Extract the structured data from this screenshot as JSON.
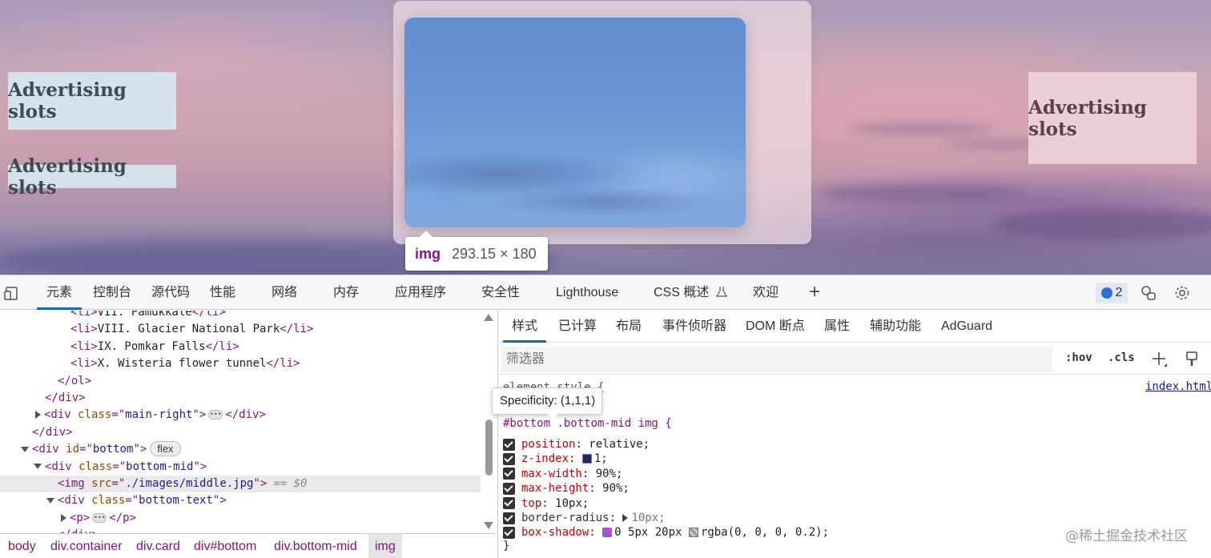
{
  "preview": {
    "ads": [
      "Advertising slots",
      "Advertising slots",
      "Advertising slots"
    ],
    "tooltip": {
      "tag": "img",
      "dims": "293.15 × 180"
    }
  },
  "devtools": {
    "tabs": [
      "元素",
      "控制台",
      "源代码",
      "性能",
      "网络",
      "内存",
      "应用程序",
      "安全性",
      "Lighthouse",
      "CSS 概述",
      "欢迎"
    ],
    "issues_count": "2",
    "elements": {
      "lines": [
        {
          "indent": 88,
          "parts": [
            [
              "tg",
              "<li>"
            ],
            [
              "txt",
              "VII. Pamukkale"
            ],
            [
              "tg",
              "</li>"
            ]
          ]
        },
        {
          "indent": 88,
          "parts": [
            [
              "tg",
              "<li>"
            ],
            [
              "txt",
              "VIII. Glacier National Park"
            ],
            [
              "tg",
              "</li>"
            ]
          ]
        },
        {
          "indent": 88,
          "parts": [
            [
              "tg",
              "<li>"
            ],
            [
              "txt",
              "IX. Pomkar Falls"
            ],
            [
              "tg",
              "</li>"
            ]
          ]
        },
        {
          "indent": 88,
          "parts": [
            [
              "tg",
              "<li>"
            ],
            [
              "txt",
              "X. Wisteria flower tunnel"
            ],
            [
              "tg",
              "</li>"
            ]
          ]
        },
        {
          "indent": 72,
          "parts": [
            [
              "tg",
              "</ol>"
            ]
          ]
        },
        {
          "indent": 56,
          "parts": [
            [
              "tg",
              "</div>"
            ]
          ]
        },
        {
          "indent": 44,
          "arrow": "right",
          "parts": [
            [
              "tg",
              "<div "
            ],
            [
              "at",
              "class"
            ],
            [
              "tg",
              "=\""
            ],
            [
              "av",
              "main-right"
            ],
            [
              "tg",
              "\">"
            ],
            [
              "ell",
              ""
            ],
            [
              "tg",
              "</div>"
            ]
          ]
        },
        {
          "indent": 40,
          "parts": [
            [
              "tg",
              "</div>"
            ]
          ]
        },
        {
          "indent": 26,
          "arrow": "down",
          "parts": [
            [
              "tg",
              "<div "
            ],
            [
              "at",
              "id"
            ],
            [
              "tg",
              "=\""
            ],
            [
              "av",
              "bottom"
            ],
            [
              "tg",
              "\">"
            ],
            [
              "pill",
              "flex"
            ]
          ]
        },
        {
          "indent": 42,
          "arrow": "down",
          "parts": [
            [
              "tg",
              "<div "
            ],
            [
              "at",
              "class"
            ],
            [
              "tg",
              "=\""
            ],
            [
              "av",
              "bottom-mid"
            ],
            [
              "tg",
              "\">"
            ]
          ]
        },
        {
          "indent": 72,
          "sel": true,
          "parts": [
            [
              "tg",
              "<img "
            ],
            [
              "at",
              "src"
            ],
            [
              "tg",
              "=\""
            ],
            [
              "av",
              "./images/middle.jpg"
            ],
            [
              "tg",
              "\">"
            ],
            [
              "eq",
              "== $0"
            ]
          ]
        },
        {
          "indent": 58,
          "arrow": "down",
          "parts": [
            [
              "tg",
              "<div "
            ],
            [
              "at",
              "class"
            ],
            [
              "tg",
              "=\""
            ],
            [
              "av",
              "bottom-text"
            ],
            [
              "tg",
              "\">"
            ]
          ]
        },
        {
          "indent": 76,
          "arrow": "right",
          "parts": [
            [
              "tg",
              "<p>"
            ],
            [
              "ell",
              ""
            ],
            [
              "tg",
              "</p>"
            ]
          ]
        },
        {
          "indent": 72,
          "parts": [
            [
              "tg",
              "</div>"
            ]
          ]
        }
      ]
    },
    "breadcrumbs": [
      "body",
      "div.container",
      "div.card",
      "div#bottom",
      "div.bottom-mid",
      "img"
    ],
    "styles": {
      "subtabs": [
        "样式",
        "已计算",
        "布局",
        "事件侦听器",
        "DOM 断点",
        "属性",
        "辅助功能",
        "AdGuard"
      ],
      "filter_placeholder": "筛选器",
      "hov": ":hov",
      "cls": ".cls",
      "element_style": "element.style {",
      "specificity": "Specificity: (1,1,1)",
      "selector": "#bottom .bottom-mid img {",
      "source": "index.html",
      "rules": [
        {
          "prop": "position",
          "value": "relative;"
        },
        {
          "prop": "z-index",
          "value": "1;",
          "swatch": "#1a2a6a"
        },
        {
          "prop": "max-width",
          "value": "90%;"
        },
        {
          "prop": "max-height",
          "value": "90%;"
        },
        {
          "prop": "top",
          "value": "10px;"
        },
        {
          "prop": "border-radius",
          "value": "10px;",
          "dim": true,
          "expand": true
        },
        {
          "prop": "box-shadow",
          "value": "0 5px 20px",
          "swatch2": "rgba(0, 0, 0, 0.2);"
        }
      ],
      "closing": "}"
    },
    "watermark": "@稀土掘金技术社区"
  }
}
